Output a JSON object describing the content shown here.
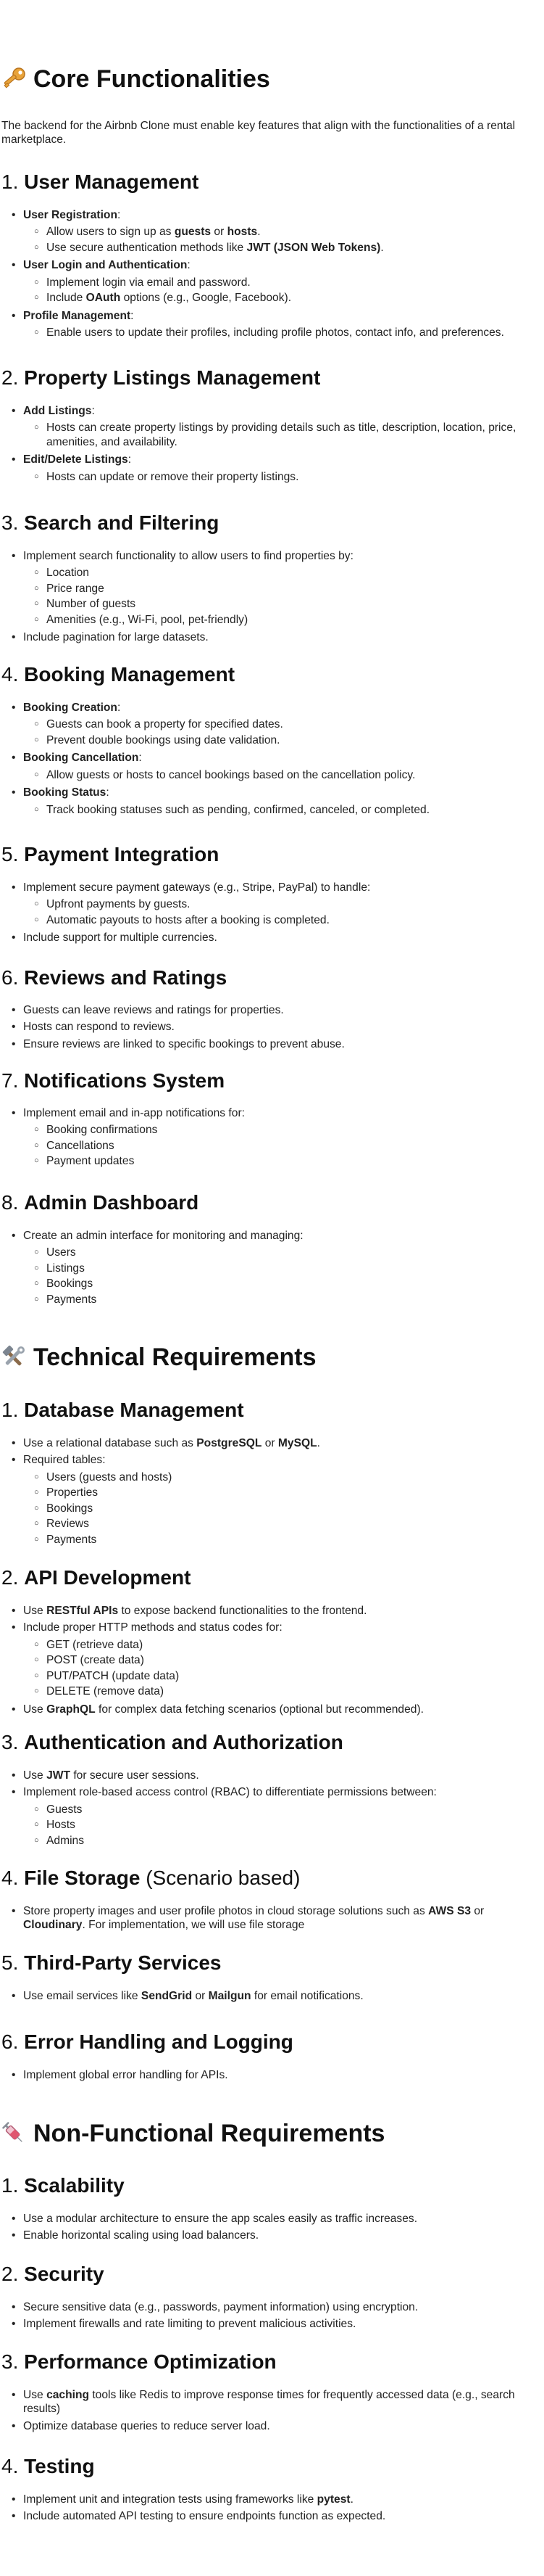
{
  "core": {
    "icon": "key-emoji-icon",
    "title": "Core Functionalities",
    "intro": "The backend for the Airbnb Clone must enable key features that align with the functionalities of a rental marketplace.",
    "sections": [
      {
        "num": "1.",
        "title": "User Management"
      },
      {
        "num": "2.",
        "title": "Property Listings Management"
      },
      {
        "num": "3.",
        "title": "Search and Filtering"
      },
      {
        "num": "4.",
        "title": "Booking Management"
      },
      {
        "num": "5.",
        "title": "Payment Integration"
      },
      {
        "num": "6.",
        "title": "Reviews and Ratings"
      },
      {
        "num": "7.",
        "title": "Notifications System"
      },
      {
        "num": "8.",
        "title": "Admin Dashboard"
      }
    ]
  },
  "tech": {
    "icon": "hammer-and-wrench-emoji-icon",
    "title": "Technical Requirements",
    "sections": [
      {
        "num": "1.",
        "title": "Database Management"
      },
      {
        "num": "2.",
        "title": "API Development"
      },
      {
        "num": "3.",
        "title": "Authentication and Authorization"
      },
      {
        "num": "4.",
        "title": "File Storage",
        "suffix": "(Scenario based)"
      },
      {
        "num": "5.",
        "title": "Third-Party Services"
      },
      {
        "num": "6.",
        "title": "Error Handling and Logging"
      }
    ]
  },
  "nonfunc": {
    "icon": "syringe-emoji-icon",
    "title": "Non-Functional Requirements",
    "sections": [
      {
        "num": "1.",
        "title": "Scalability"
      },
      {
        "num": "2.",
        "title": "Security"
      },
      {
        "num": "3.",
        "title": "Performance Optimization"
      },
      {
        "num": "4.",
        "title": "Testing"
      }
    ]
  },
  "text": {
    "um_reg": "User Registration",
    "um_reg_1a": "Allow users to sign up as ",
    "um_reg_1b": "guests",
    "um_reg_1c": " or ",
    "um_reg_1d": "hosts",
    "um_reg_1e": ".",
    "um_reg_2a": "Use secure authentication methods like ",
    "um_reg_2b": "JWT (JSON Web Tokens)",
    "um_reg_2c": ".",
    "um_login": "User Login and Authentication",
    "um_login_1": "Implement login via email and password.",
    "um_login_2a": "Include ",
    "um_login_2b": "OAuth",
    "um_login_2c": " options (e.g., Google, Facebook).",
    "um_prof": "Profile Management",
    "um_prof_1": "Enable users to update their profiles, including profile photos, contact info, and preferences.",
    "pl_add": "Add Listings",
    "pl_add_1": "Hosts can create property listings by providing details such as title, description, location, price, amenities, and availability.",
    "pl_edit": "Edit/Delete Listings",
    "pl_edit_1": "Hosts can update or remove their property listings.",
    "sf_1": "Implement search functionality to allow users to find properties by:",
    "sf_1a": "Location",
    "sf_1b": "Price range",
    "sf_1c": "Number of guests",
    "sf_1d": "Amenities (e.g., Wi-Fi, pool, pet-friendly)",
    "sf_2": "Include pagination for large datasets.",
    "bm_create": "Booking Creation",
    "bm_create_1": "Guests can book a property for specified dates.",
    "bm_create_2": "Prevent double bookings using date validation.",
    "bm_cancel": "Booking Cancellation",
    "bm_cancel_1": "Allow guests or hosts to cancel bookings based on the cancellation policy.",
    "bm_status": "Booking Status",
    "bm_status_1": "Track booking statuses such as pending, confirmed, canceled, or completed.",
    "pi_1": "Implement secure payment gateways (e.g., Stripe, PayPal) to handle:",
    "pi_1a": "Upfront payments by guests.",
    "pi_1b": "Automatic payouts to hosts after a booking is completed.",
    "pi_2": "Include support for multiple currencies.",
    "rr_1": "Guests can leave reviews and ratings for properties.",
    "rr_2": "Hosts can respond to reviews.",
    "rr_3": "Ensure reviews are linked to specific bookings to prevent abuse.",
    "ns_1": "Implement email and in-app notifications for:",
    "ns_1a": "Booking confirmations",
    "ns_1b": "Cancellations",
    "ns_1c": "Payment updates",
    "ad_1": "Create an admin interface for monitoring and managing:",
    "ad_1a": "Users",
    "ad_1b": "Listings",
    "ad_1c": "Bookings",
    "ad_1d": "Payments",
    "db_1a": "Use a relational database such as ",
    "db_1b": "PostgreSQL",
    "db_1c": " or ",
    "db_1d": "MySQL",
    "db_1e": ".",
    "db_2": "Required tables:",
    "db_2a": "Users (guests and hosts)",
    "db_2b": "Properties",
    "db_2c": "Bookings",
    "db_2d": "Reviews",
    "db_2e": "Payments",
    "api_1a": "Use ",
    "api_1b": "RESTful APIs",
    "api_1c": " to expose backend functionalities to the frontend.",
    "api_2": "Include proper HTTP methods and status codes for:",
    "api_2a": "GET (retrieve data)",
    "api_2b": "POST (create data)",
    "api_2c": "PUT/PATCH (update data)",
    "api_2d": "DELETE (remove data)",
    "api_3a": "Use ",
    "api_3b": "GraphQL",
    "api_3c": " for complex data fetching scenarios (optional but recommended).",
    "auth_1a": "Use ",
    "auth_1b": "JWT",
    "auth_1c": " for secure user sessions.",
    "auth_2": "Implement role-based access control (RBAC) to differentiate permissions between:",
    "auth_2a": "Guests",
    "auth_2b": "Hosts",
    "auth_2c": "Admins",
    "fs_1a": "Store property images and user profile photos in cloud storage solutions such as ",
    "fs_1b": "AWS S3",
    "fs_1c": " or ",
    "fs_1d": "Cloudinary",
    "fs_1e": ". For implementation, we will use file storage",
    "tp_1a": "Use email services like ",
    "tp_1b": "SendGrid",
    "tp_1c": " or ",
    "tp_1d": "Mailgun",
    "tp_1e": " for email notifications.",
    "eh_1": "Implement global error handling for APIs.",
    "sc_1": "Use a modular architecture to ensure the app scales easily as traffic increases.",
    "sc_2": "Enable horizontal scaling using load balancers.",
    "se_1": "Secure sensitive data (e.g., passwords, payment information) using encryption.",
    "se_2": "Implement firewalls and rate limiting to prevent malicious activities.",
    "po_1a": "Use ",
    "po_1b": "caching",
    "po_1c": " tools like Redis to improve response times for frequently accessed data (e.g., search results)",
    "po_2": "Optimize database queries to reduce server load.",
    "ts_1a": "Implement unit and integration tests using frameworks like ",
    "ts_1b": "pytest",
    "ts_1c": ".",
    "ts_2": "Include automated API testing to ensure endpoints function as expected."
  }
}
